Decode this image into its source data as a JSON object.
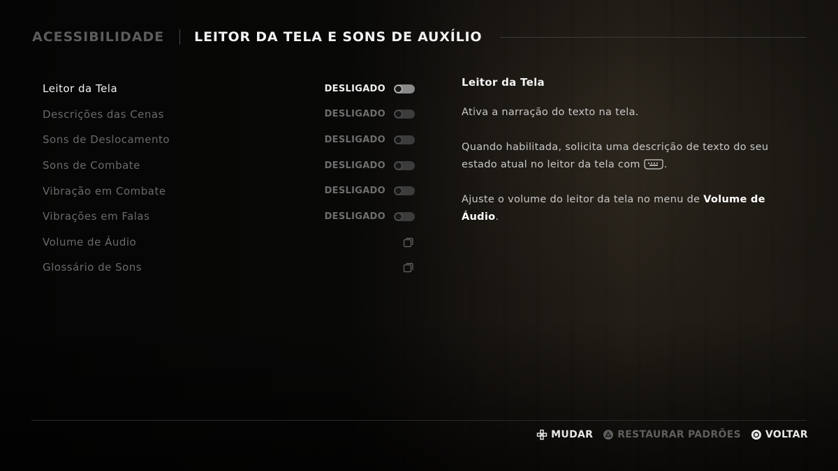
{
  "header": {
    "parent": "ACESSIBILIDADE",
    "current": "LEITOR DA TELA E SONS DE AUXÍLIO"
  },
  "menu": {
    "items": [
      {
        "label": "Leitor da Tela",
        "value": "DESLIGADO",
        "control": "toggle",
        "selected": true
      },
      {
        "label": "Descrições das Cenas",
        "value": "DESLIGADO",
        "control": "toggle"
      },
      {
        "label": "Sons de Deslocamento",
        "value": "DESLIGADO",
        "control": "toggle"
      },
      {
        "label": "Sons de Combate",
        "value": "DESLIGADO",
        "control": "toggle"
      },
      {
        "label": "Vibração em Combate",
        "value": "DESLIGADO",
        "control": "toggle"
      },
      {
        "label": "Vibrações em Falas",
        "value": "DESLIGADO",
        "control": "toggle"
      },
      {
        "label": "Volume de Áudio",
        "control": "submenu-icon"
      },
      {
        "label": "Glossário de Sons",
        "control": "submenu-icon"
      }
    ]
  },
  "description": {
    "title": "Leitor da Tela",
    "p1": "Ativa a narração do texto na tela.",
    "p2": "Quando habilitada, solicita uma descrição de texto do seu estado atual no leitor da tela com",
    "p2_end": ".",
    "p2_icon": "touchpad-icon",
    "p3_before": "Ajuste o volume do leitor da tela no menu de ",
    "p3_bold": "Volume de Áudio",
    "p3_after": "."
  },
  "footer": {
    "change": {
      "label": "MUDAR",
      "icon": "dpad-icon"
    },
    "restore": {
      "label": "RESTAURAR PADRÕES",
      "icon": "triangle-button-icon"
    },
    "back": {
      "label": "VOLTAR",
      "icon": "circle-button-icon"
    }
  }
}
